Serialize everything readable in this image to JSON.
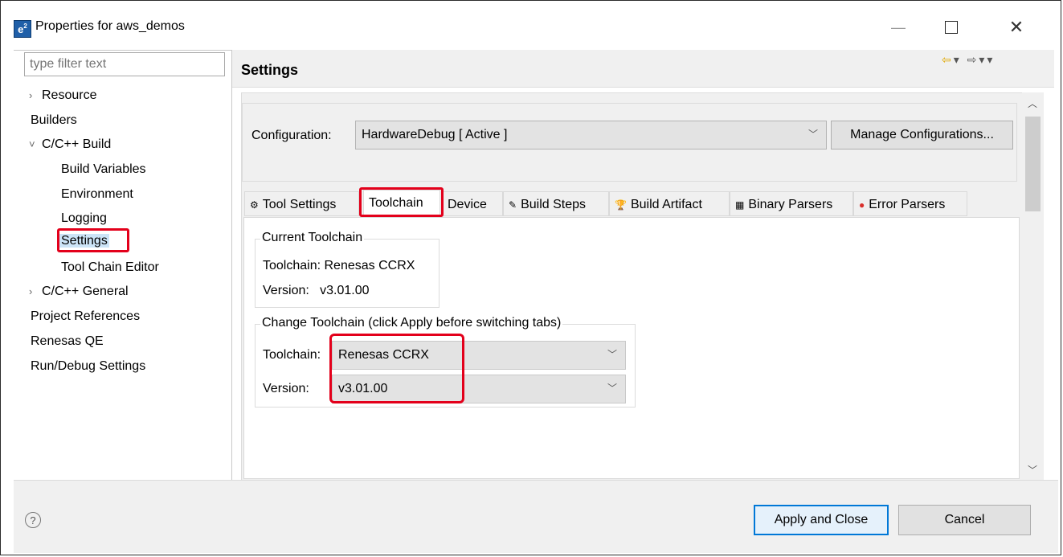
{
  "window": {
    "title": "Properties for aws_demos",
    "icon_text": "e",
    "icon_sup": "2",
    "minimize_icon": "—",
    "close_icon": "✕"
  },
  "filter": {
    "placeholder": "type filter text"
  },
  "tree": [
    {
      "label": "Resource",
      "arrow": "›"
    },
    {
      "label": "Builders",
      "arrow": ""
    },
    {
      "label": "C/C++ Build",
      "arrow": "˅"
    },
    {
      "label": "Build Variables",
      "arrow": ""
    },
    {
      "label": "Environment",
      "arrow": ""
    },
    {
      "label": "Logging",
      "arrow": ""
    },
    {
      "label": "Settings",
      "arrow": "",
      "selected": true
    },
    {
      "label": "Tool Chain Editor",
      "arrow": ""
    },
    {
      "label": "C/C++ General",
      "arrow": "›"
    },
    {
      "label": "Project References",
      "arrow": ""
    },
    {
      "label": "Renesas QE",
      "arrow": ""
    },
    {
      "label": "Run/Debug Settings",
      "arrow": ""
    }
  ],
  "header": {
    "title": "Settings",
    "nav_back": "⇦",
    "nav_forward": "⇨",
    "dropdown": "▾"
  },
  "configuration": {
    "label": "Configuration:",
    "value": "HardwareDebug  [ Active ]",
    "manage_label": "Manage Configurations..."
  },
  "tabs": [
    {
      "label": "Tool Settings",
      "icon": "⚙"
    },
    {
      "label": "Toolchain",
      "icon": "",
      "active": true
    },
    {
      "label": "Device",
      "icon": ""
    },
    {
      "label": "Build Steps",
      "icon": "✎"
    },
    {
      "label": "Build Artifact",
      "icon": "🏆"
    },
    {
      "label": "Binary Parsers",
      "icon": "▦"
    },
    {
      "label": "Error Parsers",
      "icon": "●"
    }
  ],
  "current_toolchain": {
    "title": "Current Toolchain",
    "toolchain_text": "Toolchain: Renesas CCRX",
    "version_text": "Version:   v3.01.00"
  },
  "change_toolchain": {
    "title": "Change Toolchain (click Apply before switching tabs)",
    "toolchain_label": "Toolchain:",
    "toolchain_value": "Renesas CCRX",
    "version_label": "Version:",
    "version_value": "v3.01.00"
  },
  "footer": {
    "help": "?",
    "apply_close": "Apply and Close",
    "cancel": "Cancel"
  },
  "colors": {
    "highlight_red": "#e3001b",
    "selection_blue": "#cce4f7",
    "primary_border": "#0078d7"
  },
  "icons": [
    "app-icon",
    "minimize-icon",
    "maximize-icon",
    "close-icon",
    "back-arrow-icon",
    "forward-arrow-icon",
    "chevron-down-icon",
    "help-icon"
  ]
}
